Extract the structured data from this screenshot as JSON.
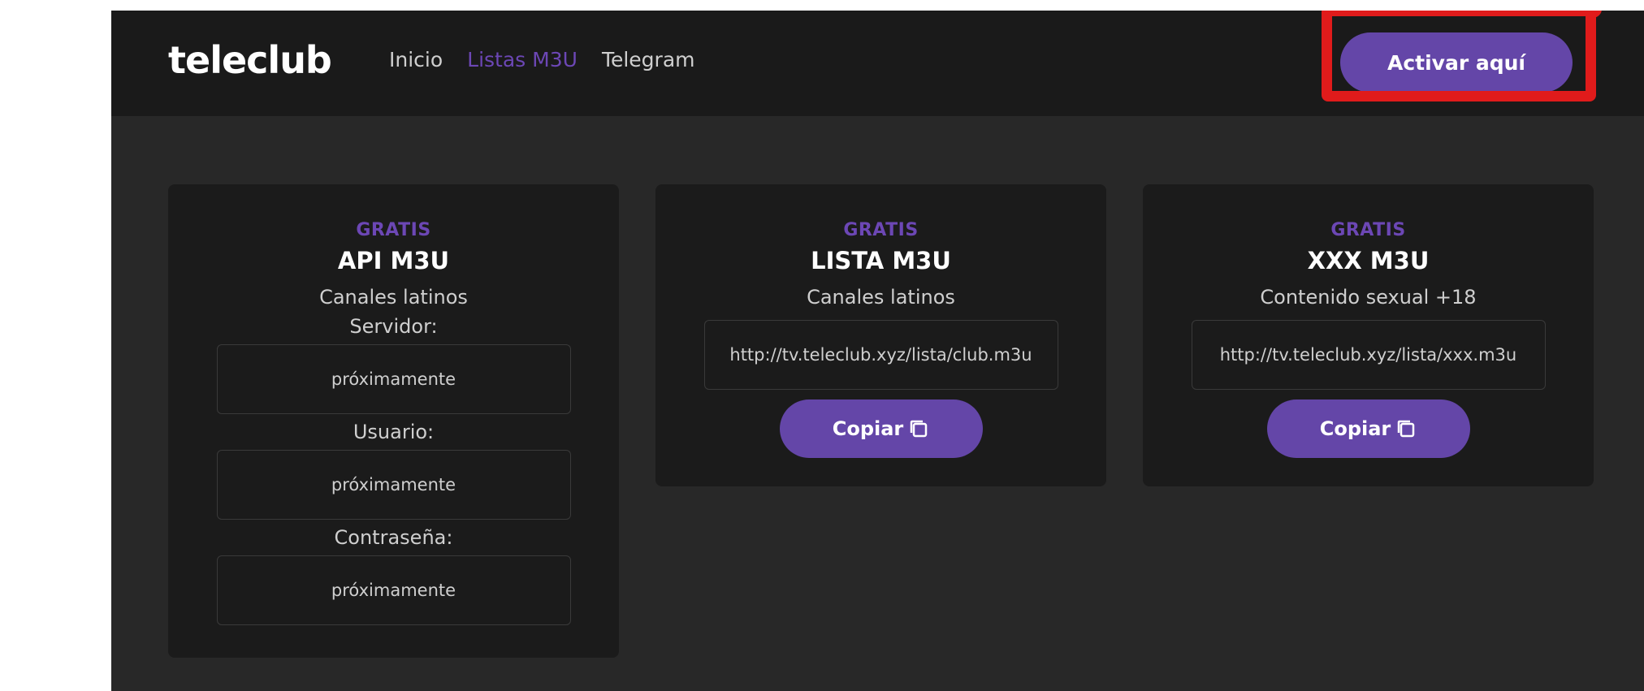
{
  "header": {
    "logo": "teleclub",
    "nav": [
      {
        "label": "Inicio",
        "active": false
      },
      {
        "label": "Listas M3U",
        "active": true
      },
      {
        "label": "Telegram",
        "active": false
      }
    ],
    "cta_label": "Activar aquí"
  },
  "cards": [
    {
      "badge": "GRATIS",
      "title": "API M3U",
      "subtitle": "Canales latinos",
      "fields": [
        {
          "label": "Servidor:",
          "value": "próximamente"
        },
        {
          "label": "Usuario:",
          "value": "próximamente"
        },
        {
          "label": "Contraseña:",
          "value": "próximamente"
        }
      ]
    },
    {
      "badge": "GRATIS",
      "title": "LISTA M3U",
      "subtitle": "Canales latinos",
      "url": "http://tv.teleclub.xyz/lista/club.m3u",
      "copy_label": "Copiar"
    },
    {
      "badge": "GRATIS",
      "title": "XXX M3U",
      "subtitle": "Contenido sexual +18",
      "url": "http://tv.teleclub.xyz/lista/xxx.m3u",
      "copy_label": "Copiar"
    }
  ],
  "colors": {
    "accent": "#6446a8",
    "nav_active": "#6c47b5",
    "highlight": "#e01b1b",
    "header_bg": "#1a1a1a",
    "page_bg": "#282828",
    "card_bg": "#1b1b1b"
  },
  "icons": {
    "copy": "copy-icon"
  }
}
